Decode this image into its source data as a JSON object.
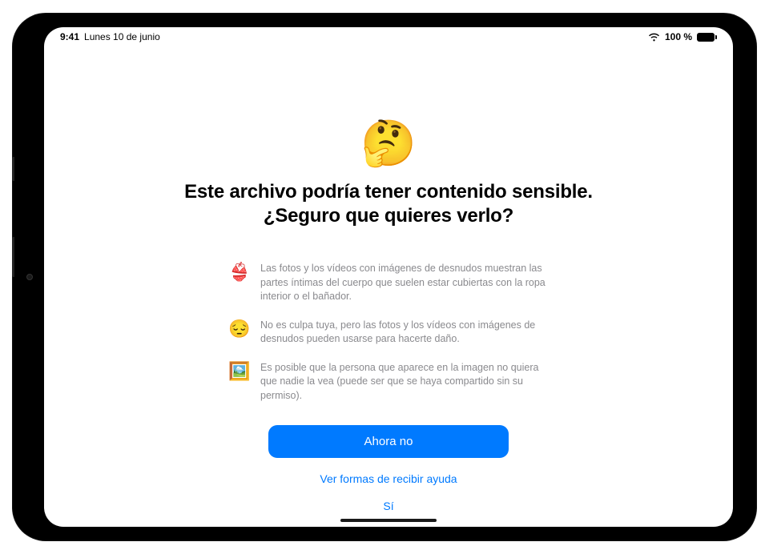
{
  "status": {
    "time": "9:41",
    "date": "Lunes 10 de junio",
    "battery_text": "100 %"
  },
  "hero": {
    "emoji": "🤔",
    "title_line1": "Este archivo podría tener contenido sensible.",
    "title_line2": "¿Seguro que quieres verlo?"
  },
  "items": [
    {
      "icon": "👙",
      "text": "Las fotos y los vídeos con imágenes de desnudos muestran las partes íntimas del cuerpo que suelen estar cubiertas con la ropa interior o el bañador."
    },
    {
      "icon": "😔",
      "text": "No es culpa tuya, pero las fotos y los vídeos con imágenes de desnudos pueden usarse para hacerte daño."
    },
    {
      "icon": "🖼️",
      "text": "Es posible que la persona que aparece en la imagen no quiera que nadie la vea (puede ser que se haya compartido sin su permiso)."
    }
  ],
  "actions": {
    "primary": "Ahora no",
    "help": "Ver formas de recibir ayuda",
    "confirm": "Sí"
  }
}
